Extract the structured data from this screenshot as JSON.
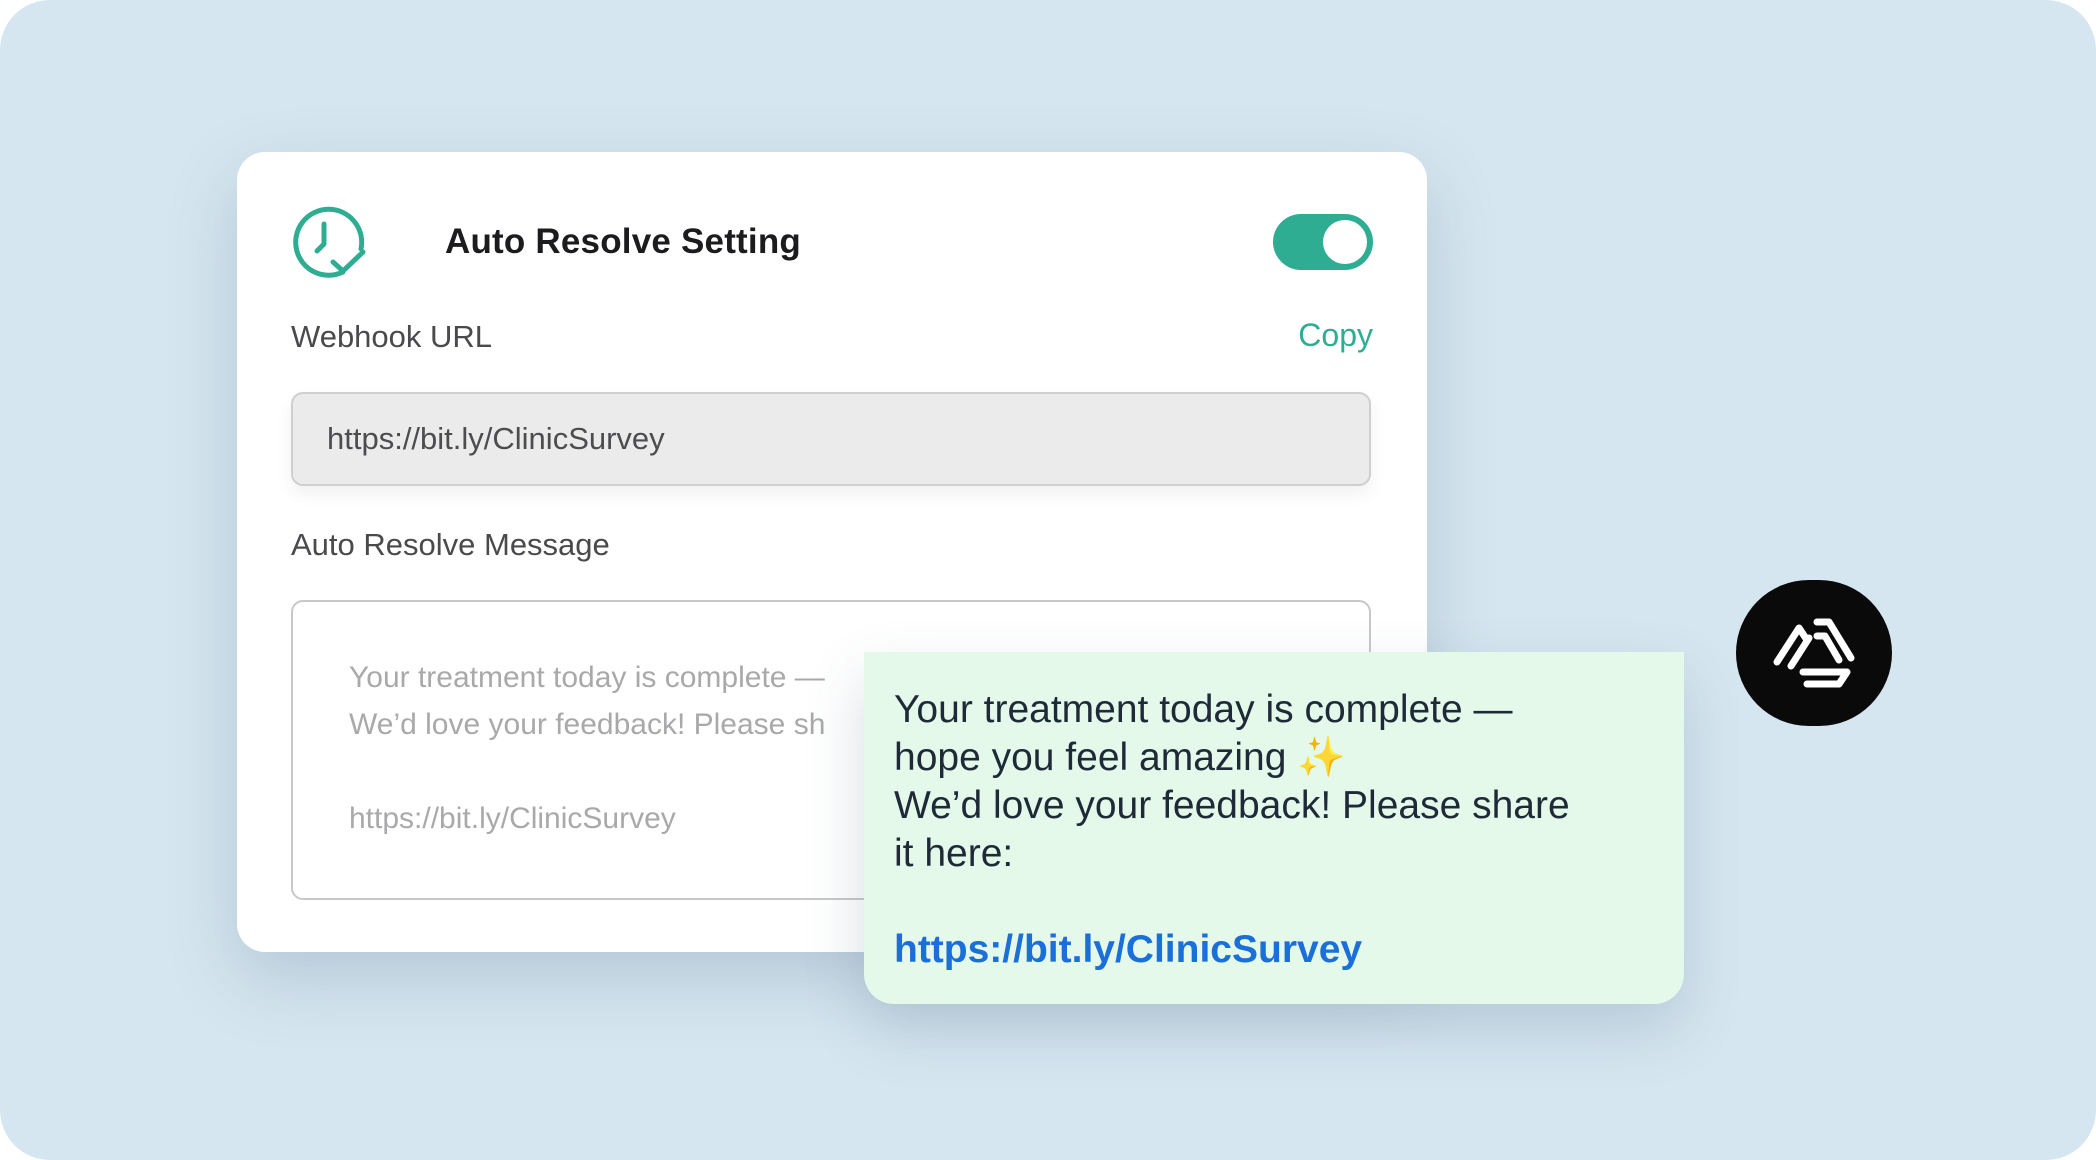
{
  "settings_card": {
    "title": "Auto Resolve Setting",
    "title_icon": "clock-check-icon",
    "toggle": {
      "state": "on",
      "color": "#2fad93"
    },
    "webhook": {
      "label": "Webhook URL",
      "copy_label": "Copy",
      "value": "https://bit.ly/ClinicSurvey"
    },
    "message": {
      "label": "Auto Resolve Message",
      "line1": "Your treatment today is complete —",
      "line2": "We’d love your feedback! Please sh",
      "link": "https://bit.ly/ClinicSurvey"
    }
  },
  "chat_bubble": {
    "line1": "Your treatment today is complete —",
    "line2": "hope you feel amazing",
    "sparkle": "✨",
    "line3": "We’d love your feedback! Please share",
    "line4": "it here:",
    "link": "https://bit.ly/ClinicSurvey",
    "background": "#e4f9ea",
    "link_color": "#1b6fd8"
  },
  "brand_badge": {
    "icon": "brand-logo-icon"
  },
  "colors": {
    "background": "#d6e6f0",
    "accent": "#2fad93"
  }
}
